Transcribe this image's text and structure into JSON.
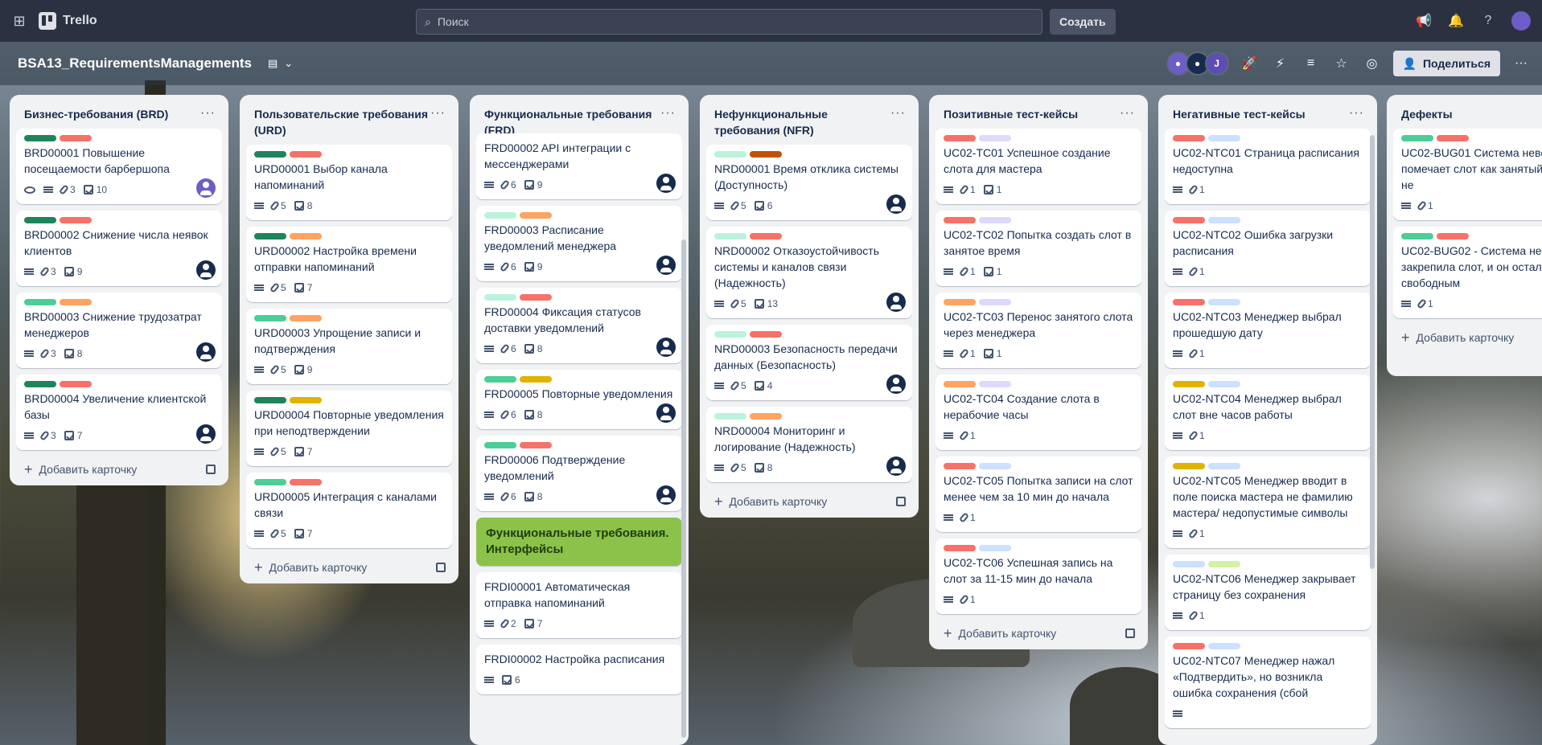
{
  "topbar": {
    "app_name": "Trello",
    "search_placeholder": "Поиск",
    "create_label": "Создать"
  },
  "board": {
    "title": "BSA13_RequirementsManagements",
    "share_label": "Поделиться",
    "member_initial": "J"
  },
  "labels_colors": {
    "green": "#1f845a",
    "red": "#f87168",
    "lightgreen": "#4bce97",
    "orange": "#fea362",
    "yellow": "#e2b203",
    "brown": "#c25100",
    "mint": "#baf3db",
    "lavender": "#dfd8fd",
    "blue": "#cce0ff",
    "lime": "#d3f1a7"
  },
  "add_card_label": "Добавить карточку",
  "lists": [
    {
      "title": "Бизнес-требования (BRD)",
      "cards": [
        {
          "labels": [
            "green",
            "red"
          ],
          "title": "BRD00001 Повышение посещаемости барбершопа",
          "eye": true,
          "attach": "3",
          "check": "10",
          "avatar": "purple"
        },
        {
          "labels": [
            "green",
            "red"
          ],
          "title": "BRD00002 Снижение числа неявок клиентов",
          "attach": "3",
          "check": "9",
          "avatar": "dark"
        },
        {
          "labels": [
            "lightgreen",
            "orange"
          ],
          "title": "BRD00003 Снижение трудозатрат менеджеров",
          "attach": "3",
          "check": "8",
          "avatar": "dark"
        },
        {
          "labels": [
            "green",
            "red"
          ],
          "title": "BRD00004 Увеличение клиентской базы",
          "attach": "3",
          "check": "7",
          "avatar": "dark"
        }
      ]
    },
    {
      "title": "Пользовательские требования (URD)",
      "cards": [
        {
          "labels": [
            "green",
            "red"
          ],
          "title": "URD00001 Выбор канала напоминаний",
          "attach": "5",
          "check": "8"
        },
        {
          "labels": [
            "green",
            "orange"
          ],
          "title": "URD00002 Настройка времени отправки напоминаний",
          "attach": "5",
          "check": "7"
        },
        {
          "labels": [
            "lightgreen",
            "orange"
          ],
          "title": "URD00003 Упрощение записи и подтверждения",
          "attach": "5",
          "check": "9"
        },
        {
          "labels": [
            "green",
            "yellow"
          ],
          "title": "URD00004 Повторные уведомления при неподтверждении",
          "attach": "5",
          "check": "7"
        },
        {
          "labels": [
            "lightgreen",
            "red"
          ],
          "title": "URD00005 Интеграция с каналами связи",
          "attach": "5",
          "check": "7"
        }
      ]
    },
    {
      "title": "Функциональные требования (FRD)",
      "cards": [
        {
          "labels": [],
          "title": "FRD00002 API интеграции с мессенджерами",
          "attach": "6",
          "check": "9",
          "avatar": "dark"
        },
        {
          "labels": [
            "mint",
            "orange"
          ],
          "title": "FRD00003 Расписание уведомлений менеджера",
          "attach": "6",
          "check": "9",
          "avatar": "dark"
        },
        {
          "labels": [
            "mint",
            "red"
          ],
          "title": "FRD00004 Фиксация статусов доставки уведомлений",
          "attach": "6",
          "check": "8",
          "avatar": "dark"
        },
        {
          "labels": [
            "lightgreen",
            "yellow"
          ],
          "title": "FRD00005 Повторные уведомления",
          "attach": "6",
          "check": "8",
          "avatar": "dark"
        },
        {
          "labels": [
            "lightgreen",
            "red"
          ],
          "title": "FRD00006 Подтверждение уведомлений",
          "attach": "6",
          "check": "8",
          "avatar": "dark"
        },
        {
          "section": true,
          "title": "Функциональные требования. Интерфейсы"
        },
        {
          "labels": [],
          "title": "FRDI00001 Автоматическая отправка напоминаний",
          "attach": "2",
          "check": "7"
        },
        {
          "labels": [],
          "title": "FRDI00002 Настройка расписания",
          "check": "6"
        }
      ]
    },
    {
      "title": "Нефункциональные требования (NFR)",
      "cards": [
        {
          "labels": [
            "mint",
            "brown"
          ],
          "title": "NRD00001 Время отклика системы (Доступность)",
          "attach": "5",
          "check": "6",
          "avatar": "dark"
        },
        {
          "labels": [
            "mint",
            "red"
          ],
          "title": "NRD00002 Отказоустойчивость системы и каналов связи (Надежность)",
          "attach": "5",
          "check": "13",
          "avatar": "dark"
        },
        {
          "labels": [
            "mint",
            "red"
          ],
          "title": "NRD00003 Безопасность передачи данных (Безопасность)",
          "attach": "5",
          "check": "4",
          "avatar": "dark"
        },
        {
          "labels": [
            "mint",
            "orange"
          ],
          "title": "NRD00004 Мониторинг и логирование (Надежность)",
          "attach": "5",
          "check": "8",
          "avatar": "dark"
        }
      ]
    },
    {
      "title": "Позитивные тест-кейсы",
      "cards": [
        {
          "labels": [
            "red",
            "lavender"
          ],
          "title": "UC02-TC01 Успешное создание слота для мастера",
          "attach": "1",
          "check": "1"
        },
        {
          "labels": [
            "red",
            "lavender"
          ],
          "title": "UC02-TC02 Попытка создать слот в занятое время",
          "attach": "1",
          "check": "1"
        },
        {
          "labels": [
            "orange",
            "lavender"
          ],
          "title": "UC02-TC03 Перенос занятого слота через менеджера",
          "attach": "1",
          "check": "1"
        },
        {
          "labels": [
            "orange",
            "lavender"
          ],
          "title": "UC02-TC04 Создание слота в нерабочие часы",
          "attach": "1"
        },
        {
          "labels": [
            "red",
            "blue"
          ],
          "title": "UC02-TC05 Попытка записи на слот менее чем за 10 мин до начала",
          "attach": "1"
        },
        {
          "labels": [
            "red",
            "blue"
          ],
          "title": "UC02-TC06 Успешная запись на слот за 11-15 мин до начала",
          "attach": "1"
        }
      ]
    },
    {
      "title": "Негативные тест-кейсы",
      "cards": [
        {
          "labels": [
            "red",
            "blue"
          ],
          "title": "UC02-NTC01 Страница расписания недоступна",
          "attach": "1"
        },
        {
          "labels": [
            "red",
            "blue"
          ],
          "title": "UC02-NTC02 Ошибка загрузки расписания",
          "attach": "1"
        },
        {
          "labels": [
            "red",
            "blue"
          ],
          "title": "UC02-NTC03 Менеджер выбрал прошедшую дату",
          "attach": "1"
        },
        {
          "labels": [
            "yellow",
            "blue"
          ],
          "title": "UC02-NTC04 Менеджер выбрал слот вне часов работы",
          "attach": "1"
        },
        {
          "labels": [
            "yellow",
            "blue"
          ],
          "title": "UC02-NTC05 Менеджер вводит в поле поиска мастера не фамилию мастера/ недопустимые символы",
          "attach": "1"
        },
        {
          "labels": [
            "blue",
            "lime"
          ],
          "title": "UC02-NTC06 Менеджер закрывает страницу без сохранения",
          "attach": "1"
        },
        {
          "labels": [
            "red",
            "blue"
          ],
          "title": "UC02-NTC07 Менеджер нажал «Подтвердить», но возникла ошибка сохранения (сбой"
        }
      ]
    },
    {
      "title": "Дефекты",
      "cards": [
        {
          "labels": [
            "lightgreen",
            "red"
          ],
          "title": "UC02-BUG01 Система неверно помечает слот как занятый, клиент не",
          "attach": "1"
        },
        {
          "labels": [
            "lightgreen",
            "red"
          ],
          "title": "UC02-BUG02 - Система не закрепила слот, и он остался свободным",
          "attach": "1"
        }
      ]
    }
  ]
}
